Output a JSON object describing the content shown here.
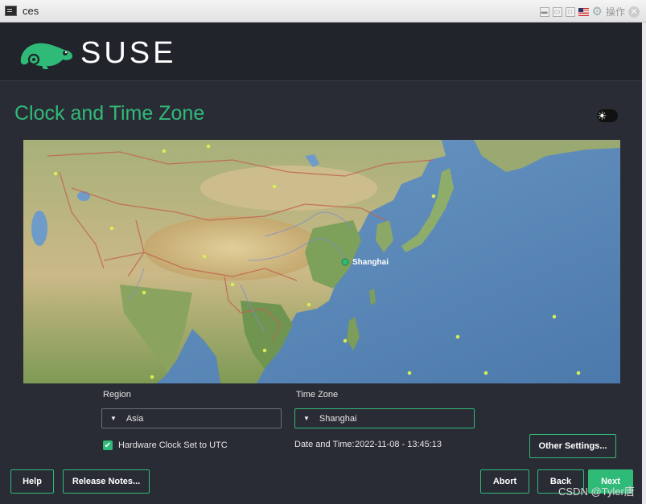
{
  "window": {
    "title": "ces",
    "ops_label": "操作"
  },
  "header": {
    "brand": "SUSE"
  },
  "page": {
    "title": "Clock and Time Zone"
  },
  "map": {
    "marker_label": "Shanghai"
  },
  "region": {
    "label": "Region",
    "value": "Asia"
  },
  "timezone": {
    "label": "Time Zone",
    "value": "Shanghai"
  },
  "hardware_clock": {
    "label": "Hardware Clock Set to UTC",
    "checked": true
  },
  "datetime": {
    "label": "Date and Time:",
    "value": "2022-11-08 - 13:45:13"
  },
  "buttons": {
    "other_settings": "Other Settings...",
    "help": "Help",
    "release_notes": "Release Notes...",
    "abort": "Abort",
    "back": "Back",
    "next": "Next"
  },
  "watermark": "CSDN @Tyler唐",
  "colors": {
    "accent": "#30ba78",
    "background": "#2a2c35",
    "header": "#22242c"
  },
  "icons": [
    "app-icon",
    "flag-icon",
    "gear-icon",
    "close-icon",
    "chameleon-logo",
    "sun-icon",
    "dropdown-arrow-icon",
    "check-icon"
  ]
}
